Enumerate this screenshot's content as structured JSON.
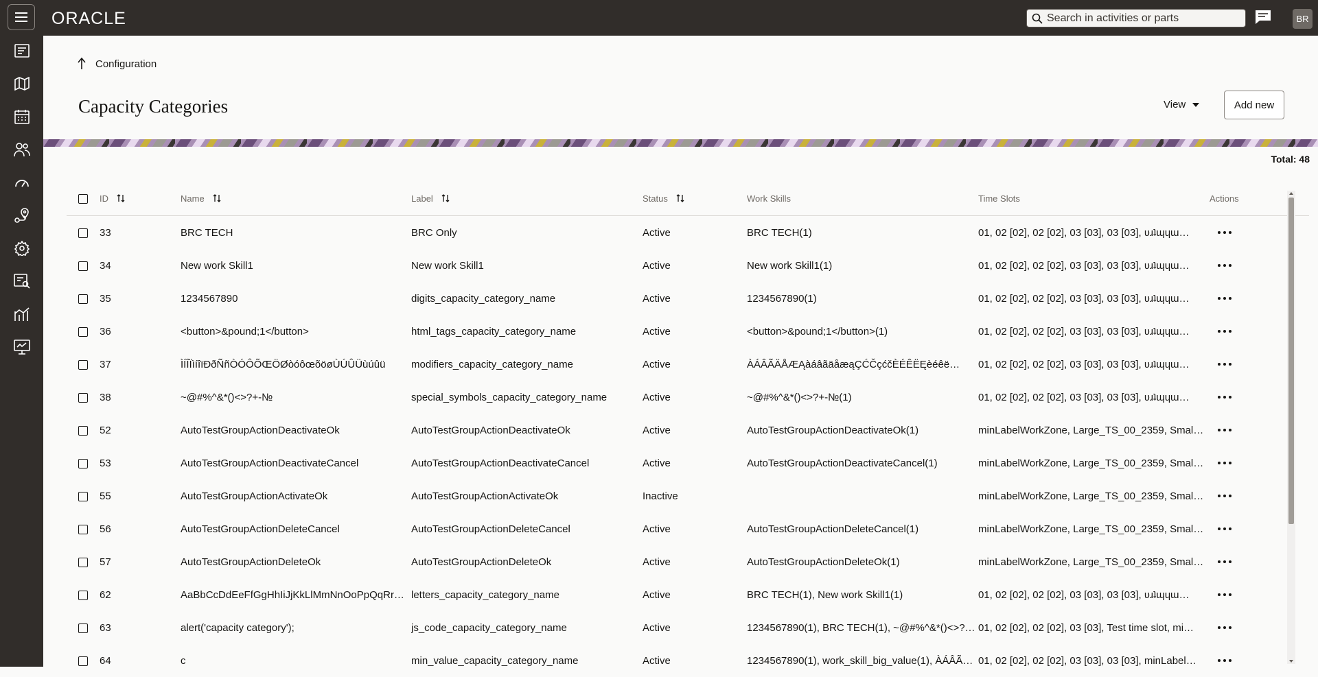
{
  "header": {
    "logo": "ORACLE",
    "search_placeholder": "Search in activities or parts",
    "avatar_initials": "BR"
  },
  "sidebar": {
    "items": [
      {
        "icon": "hamburger-menu-icon"
      },
      {
        "icon": "activity-list-icon"
      },
      {
        "icon": "map-icon"
      },
      {
        "icon": "calendar-icon"
      },
      {
        "icon": "resources-icon"
      },
      {
        "icon": "dashboard-gauge-icon"
      },
      {
        "icon": "route-location-icon"
      },
      {
        "icon": "settings-gear-icon"
      },
      {
        "icon": "reports-search-icon"
      },
      {
        "icon": "analytics-chart-icon"
      },
      {
        "icon": "monitor-icon"
      }
    ]
  },
  "breadcrumb": {
    "label": "Configuration"
  },
  "page": {
    "title": "Capacity Categories",
    "view_label": "View",
    "add_new_label": "Add new",
    "total": "Total: 48"
  },
  "table": {
    "columns": {
      "id": "ID",
      "name": "Name",
      "label": "Label",
      "status": "Status",
      "work_skills": "Work Skills",
      "time_slots": "Time Slots",
      "actions": "Actions"
    },
    "rows": [
      {
        "id": "33",
        "name": "BRC TECH",
        "label": "BRC Only",
        "status": "Active",
        "work_skills": "BRC TECH(1)",
        "time_slots": "01, 02 [02], 02 [02], 03 [03], 03 [03], ʋɹʇɰɥɯ…"
      },
      {
        "id": "34",
        "name": "New work Skill1",
        "label": "New work Skill1",
        "status": "Active",
        "work_skills": "New work Skill1(1)",
        "time_slots": "01, 02 [02], 02 [02], 03 [03], 03 [03], ʋɹʇɰɥɯ…"
      },
      {
        "id": "35",
        "name": "1234567890",
        "label": "digits_capacity_category_name",
        "status": "Active",
        "work_skills": "1234567890(1)",
        "time_slots": "01, 02 [02], 02 [02], 03 [03], 03 [03], ʋɹʇɰɥɯ…"
      },
      {
        "id": "36",
        "name": "<button>&pound;1</button>",
        "label": "html_tags_capacity_category_name",
        "status": "Active",
        "work_skills": "<button>&pound;1</button>(1)",
        "time_slots": "01, 02 [02], 02 [02], 03 [03], 03 [03], ʋɹʇɰɥɯ…"
      },
      {
        "id": "37",
        "name": "ÌÍÎÏìíîïĐðÑñÒÓÔÕŒÖØòóôœõöøÙÚÛÜùúûü",
        "label": "modifiers_capacity_category_name",
        "status": "Active",
        "work_skills": "ÀÁÂÃÄÅÆĄàáâãäåæąÇĆČçćčÈÉÊËĘèéêë…",
        "time_slots": "01, 02 [02], 02 [02], 03 [03], 03 [03], ʋɹʇɰɥɯ…"
      },
      {
        "id": "38",
        "name": "~@#%^&*()<>?+-№",
        "label": "special_symbols_capacity_category_name",
        "status": "Active",
        "work_skills": "~@#%^&*()<>?+-№(1)",
        "time_slots": "01, 02 [02], 02 [02], 03 [03], 03 [03], ʋɹʇɰɥɯ…"
      },
      {
        "id": "52",
        "name": "AutoTestGroupActionDeactivateOk",
        "label": "AutoTestGroupActionDeactivateOk",
        "status": "Active",
        "work_skills": "AutoTestGroupActionDeactivateOk(1)",
        "time_slots": "minLabelWorkZone, Large_TS_00_2359, Smal…"
      },
      {
        "id": "53",
        "name": "AutoTestGroupActionDeactivateCancel",
        "label": "AutoTestGroupActionDeactivateCancel",
        "status": "Active",
        "work_skills": "AutoTestGroupActionDeactivateCancel(1)",
        "time_slots": "minLabelWorkZone, Large_TS_00_2359, Smal…"
      },
      {
        "id": "55",
        "name": "AutoTestGroupActionActivateOk",
        "label": "AutoTestGroupActionActivateOk",
        "status": "Inactive",
        "work_skills": "",
        "time_slots": "minLabelWorkZone, Large_TS_00_2359, Smal…"
      },
      {
        "id": "56",
        "name": "AutoTestGroupActionDeleteCancel",
        "label": "AutoTestGroupActionDeleteCancel",
        "status": "Active",
        "work_skills": "AutoTestGroupActionDeleteCancel(1)",
        "time_slots": "minLabelWorkZone, Large_TS_00_2359, Smal…"
      },
      {
        "id": "57",
        "name": "AutoTestGroupActionDeleteOk",
        "label": "AutoTestGroupActionDeleteOk",
        "status": "Active",
        "work_skills": "AutoTestGroupActionDeleteOk(1)",
        "time_slots": "minLabelWorkZone, Large_TS_00_2359, Smal…"
      },
      {
        "id": "62",
        "name": "AaBbCcDdEeFfGgHhIiJjKkLlMmNnOoPpQqRr…",
        "label": "letters_capacity_category_name",
        "status": "Active",
        "work_skills": "BRC TECH(1), New work Skill1(1)",
        "time_slots": "01, 02 [02], 02 [02], 03 [03], 03 [03], ʋɹʇɰɥɯ…"
      },
      {
        "id": "63",
        "name": "alert('capacity category');",
        "label": "js_code_capacity_category_name",
        "status": "Active",
        "work_skills": "1234567890(1), BRC TECH(1), ~@#%^&*()<>?…",
        "time_slots": "01, 02 [02], 02 [02], 03 [03], Test time slot, mi…"
      },
      {
        "id": "64",
        "name": "c",
        "label": "min_value_capacity_category_name",
        "status": "Active",
        "work_skills": "1234567890(1), work_skill_big_value(1), ÀÁÂÃ…",
        "time_slots": "01, 02 [02], 02 [02], 03 [03], 03 [03], minLabel…"
      }
    ]
  }
}
